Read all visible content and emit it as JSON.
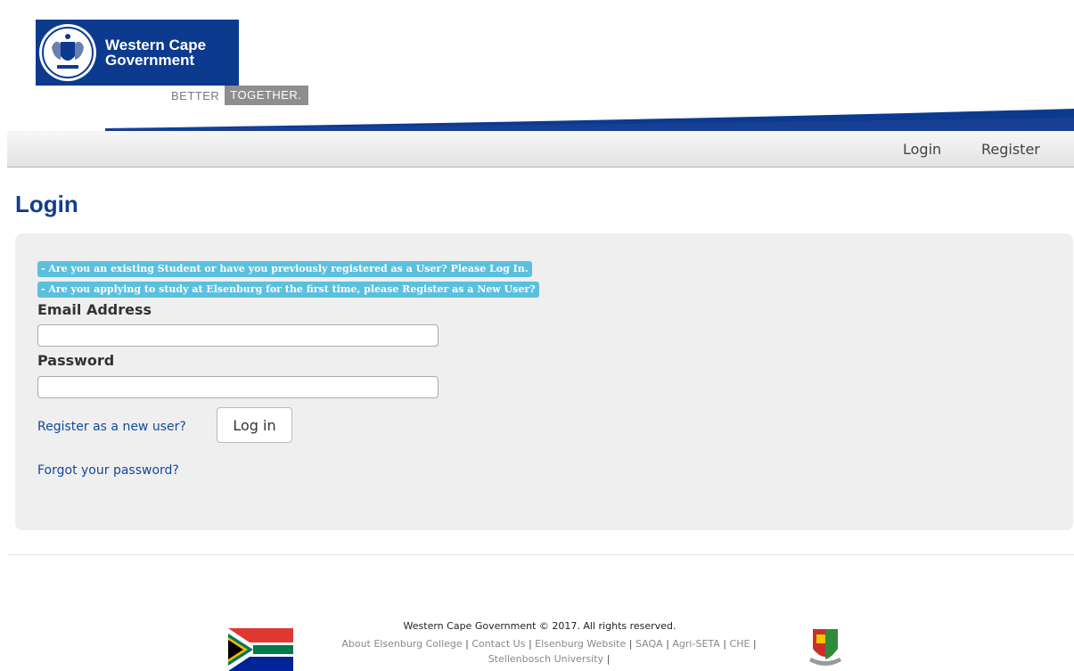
{
  "header": {
    "org_name_line1": "Western Cape",
    "org_name_line2": "Government",
    "tagline_part1": "BETTER",
    "tagline_part2": "TOGETHER."
  },
  "nav": {
    "login": "Login",
    "register": "Register"
  },
  "main": {
    "title": "Login",
    "notice_existing": "- Are you an existing Student or have you previously registered as a User? Please Log In.",
    "notice_new": "- Are you applying to study at Elsenburg for the first time, please Register as a New User?",
    "email_label": "Email Address",
    "email_value": "",
    "password_label": "Password",
    "password_value": "",
    "register_link": "Register as a new user?",
    "login_button": "Log in",
    "forgot_link": "Forgot your password?"
  },
  "footer": {
    "copyright": "Western Cape Government © 2017. All rights reserved.",
    "links": [
      "About Elsenburg College",
      "Contact Us",
      "Elsenburg Website",
      "SAQA",
      "Agri-SETA",
      "CHE",
      "Stellenbosch University"
    ],
    "separator": "|"
  },
  "colors": {
    "brand_blue": "#0b3a8f",
    "title_blue": "#123d8e",
    "notice_bg": "#5bc0de",
    "panel_bg": "#efefef"
  }
}
